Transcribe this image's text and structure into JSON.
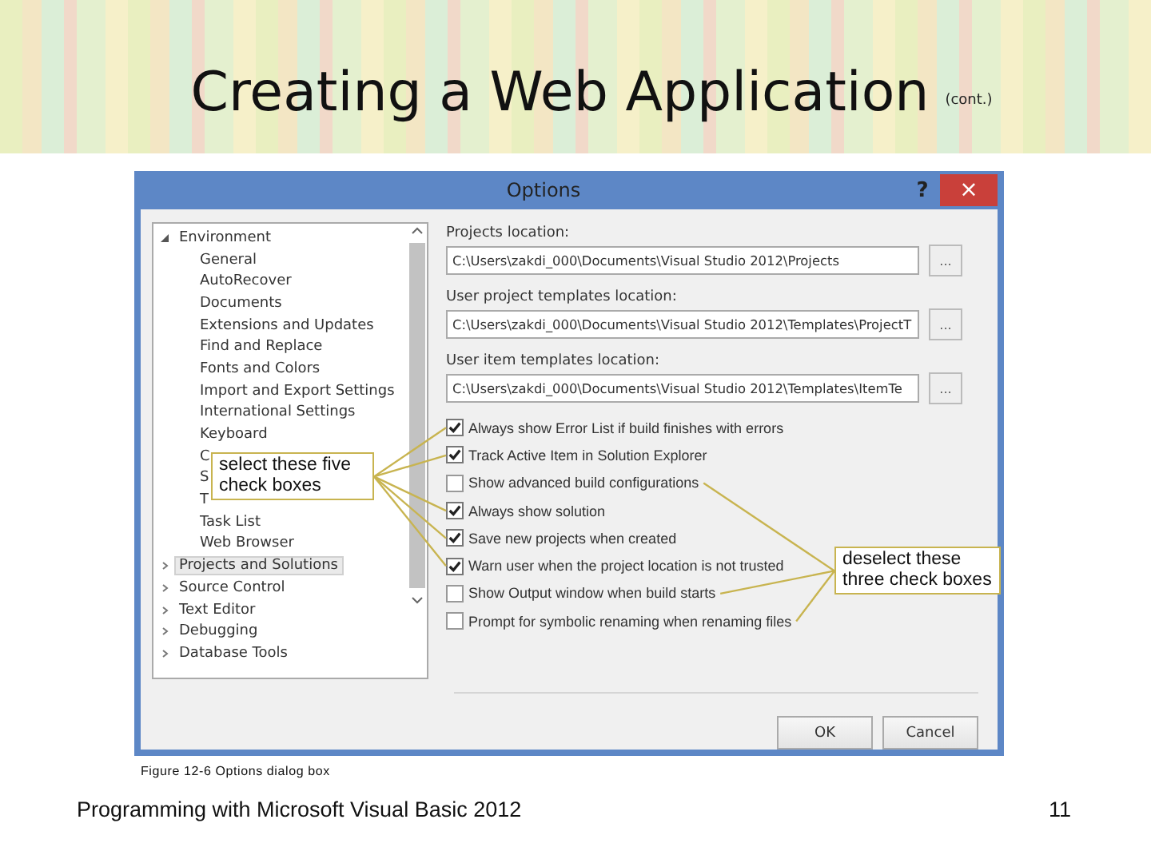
{
  "slide": {
    "title": "Creating a Web Application",
    "title_note": "(cont.)",
    "caption": "Figure 12-6 Options dialog box",
    "footer": "Programming with Microsoft Visual Basic 2012",
    "page_number": "11"
  },
  "dialog": {
    "title": "Options",
    "help": "?",
    "close": "×",
    "tree": [
      {
        "label": "Environment",
        "expanded": true,
        "selected": false,
        "children": [
          {
            "label": "General",
            "selected": false
          },
          {
            "label": "AutoRecover",
            "selected": false
          },
          {
            "label": "Documents",
            "selected": false
          },
          {
            "label": "Extensions and Updates",
            "selected": false
          },
          {
            "label": "Find and Replace",
            "selected": false
          },
          {
            "label": "Fonts and Colors",
            "selected": false
          },
          {
            "label": "Import and Export Settings",
            "selected": false
          },
          {
            "label": "International Settings",
            "selected": false
          },
          {
            "label": "Keyboard",
            "selected": false
          },
          {
            "label": "C",
            "selected": false
          },
          {
            "label": "S",
            "selected": false
          },
          {
            "label": "T",
            "selected": false
          },
          {
            "label": "Task List",
            "selected": false
          },
          {
            "label": "Web Browser",
            "selected": false
          }
        ]
      },
      {
        "label": "Projects and Solutions",
        "expanded": false,
        "selected": true
      },
      {
        "label": "Source Control",
        "expanded": false,
        "selected": false
      },
      {
        "label": "Text Editor",
        "expanded": false,
        "selected": false
      },
      {
        "label": "Debugging",
        "expanded": false,
        "selected": false
      },
      {
        "label": "Database Tools",
        "expanded": false,
        "selected": false
      }
    ],
    "fields": [
      {
        "label": "Projects location:",
        "value": "C:\\Users\\zakdi_000\\Documents\\Visual Studio 2012\\Projects",
        "browse": "..."
      },
      {
        "label": "User project templates location:",
        "value": "C:\\Users\\zakdi_000\\Documents\\Visual Studio 2012\\Templates\\ProjectT",
        "browse": "..."
      },
      {
        "label": "User item templates location:",
        "value": "C:\\Users\\zakdi_000\\Documents\\Visual Studio 2012\\Templates\\ItemTe",
        "browse": "..."
      }
    ],
    "checkboxes": [
      {
        "label": "Always show Error List if build finishes with errors",
        "checked": true
      },
      {
        "label": "Track Active Item in Solution Explorer",
        "checked": true
      },
      {
        "label": "Show advanced build configurations",
        "checked": false
      },
      {
        "label": "Always show solution",
        "checked": true
      },
      {
        "label": "Save new projects when created",
        "checked": true
      },
      {
        "label": "Warn user when the project location is not trusted",
        "checked": true
      },
      {
        "label": "Show Output window when build starts",
        "checked": false
      },
      {
        "label": "Prompt for symbolic renaming when renaming files",
        "checked": false
      }
    ],
    "buttons": [
      "OK",
      "Cancel"
    ]
  },
  "callouts": [
    {
      "text": "select these five check boxes",
      "kind": "select"
    },
    {
      "text": "deselect these three check boxes",
      "kind": "deselect"
    }
  ]
}
